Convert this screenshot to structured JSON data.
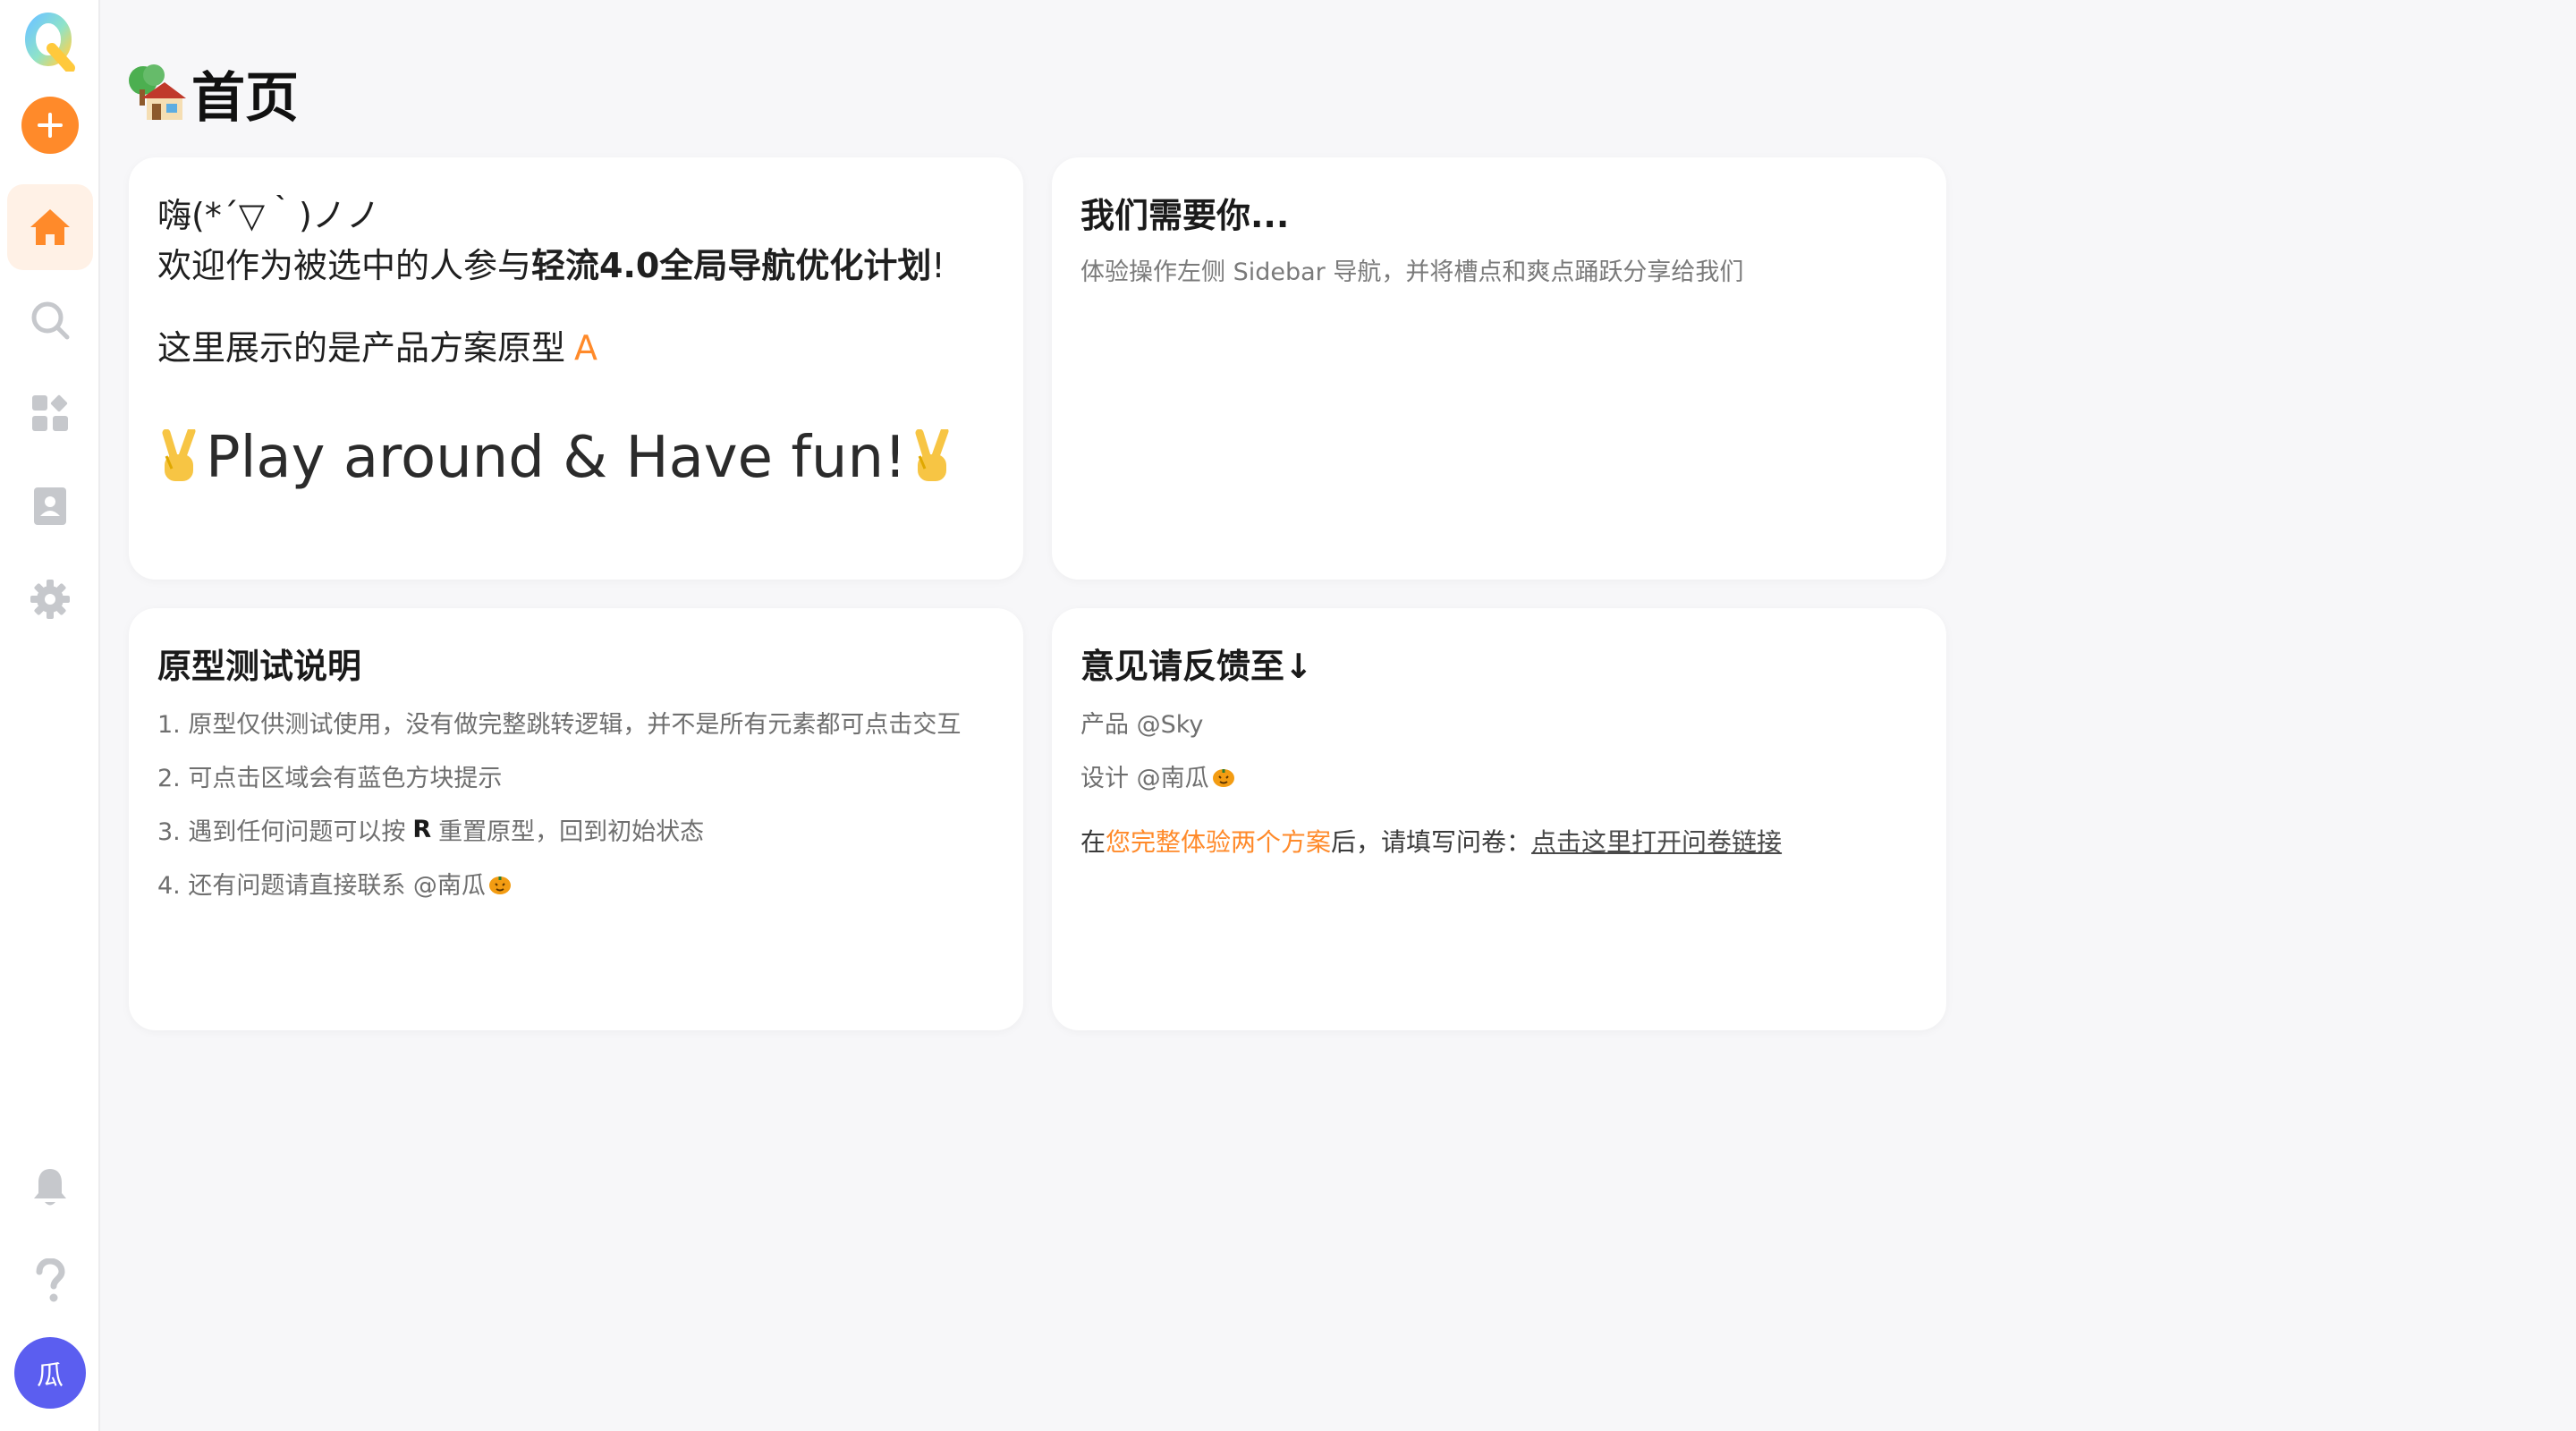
{
  "sidebar": {
    "logo_icon": "q-logo-icon",
    "items": [
      {
        "id": "home",
        "icon": "home-icon",
        "active": true
      },
      {
        "id": "search",
        "icon": "search-icon",
        "active": false
      },
      {
        "id": "apps",
        "icon": "apps-icon",
        "active": false
      },
      {
        "id": "contacts",
        "icon": "contact-card-icon",
        "active": false
      },
      {
        "id": "settings",
        "icon": "gear-icon",
        "active": false
      }
    ],
    "bottom": [
      {
        "id": "notifications",
        "icon": "bell-icon"
      },
      {
        "id": "help",
        "icon": "question-icon"
      }
    ],
    "avatar_text": "瓜"
  },
  "colors": {
    "accent": "#ff8a2a",
    "accent_soft": "#fff1e6",
    "avatar": "#5b5ef0",
    "icon_gray": "#c6c8cc"
  },
  "page": {
    "title": "首页"
  },
  "cards": {
    "welcome": {
      "greeting": "嗨(*´▽｀)ノノ",
      "welcome_prefix": "欢迎作为被选中的人参与",
      "welcome_bold": "轻流4.0全局导航优化计划",
      "welcome_suffix": "!",
      "proto_text": "这里展示的是产品方案原型",
      "proto_letter": "A",
      "fun_text": "Play around & Have fun!"
    },
    "need_you": {
      "title": "我们需要你...",
      "desc": "体验操作左侧 Sidebar 导航，并将槽点和爽点踊跃分享给我们"
    },
    "instructions": {
      "title": "原型测试说明",
      "item1": "1. 原型仅供测试使用，没有做完整跳转逻辑，并不是所有元素都可点击交互",
      "item2": "2. 可点击区域会有蓝色方块提示",
      "item3_prefix": "3. 遇到任何问题可以按",
      "item3_key": "R",
      "item3_suffix": "重置原型，回到初始状态",
      "item4": "4. 还有问题请直接联系 @南瓜"
    },
    "feedback": {
      "title": "意见请反馈至↓",
      "product": "产品 @Sky",
      "design": "设计 @南瓜",
      "survey_prefix": "在",
      "survey_accent": "您完整体验两个方案",
      "survey_mid": "后，请填写问卷：",
      "survey_link": "点击这里打开问卷链接"
    }
  }
}
